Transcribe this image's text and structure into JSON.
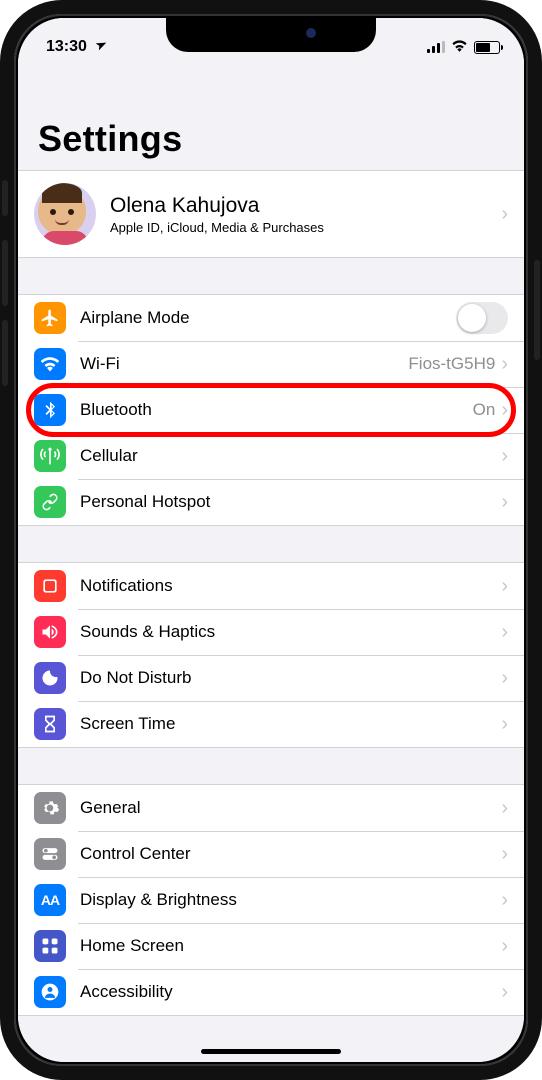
{
  "status": {
    "time": "13:30",
    "location_icon": "location-arrow",
    "signal_bars": 3,
    "wifi": true,
    "battery_percent": 60
  },
  "title": "Settings",
  "profile": {
    "name": "Olena Kahujova",
    "subtitle": "Apple ID, iCloud, Media & Purchases"
  },
  "groups": [
    {
      "rows": [
        {
          "key": "airplane",
          "label": "Airplane Mode",
          "icon": "airplane",
          "color": "#ff9500",
          "type": "toggle",
          "on": false
        },
        {
          "key": "wifi",
          "label": "Wi-Fi",
          "icon": "wifi",
          "color": "#007aff",
          "type": "link",
          "value": "Fios-tG5H9"
        },
        {
          "key": "bluetooth",
          "label": "Bluetooth",
          "icon": "bluetooth",
          "color": "#007aff",
          "type": "link",
          "value": "On",
          "highlight": true
        },
        {
          "key": "cellular",
          "label": "Cellular",
          "icon": "antenna",
          "color": "#34c759",
          "type": "link"
        },
        {
          "key": "hotspot",
          "label": "Personal Hotspot",
          "icon": "link",
          "color": "#34c759",
          "type": "link"
        }
      ]
    },
    {
      "rows": [
        {
          "key": "notifications",
          "label": "Notifications",
          "icon": "bell",
          "color": "#ff3b30",
          "type": "link"
        },
        {
          "key": "sounds",
          "label": "Sounds & Haptics",
          "icon": "speaker",
          "color": "#ff2d55",
          "type": "link"
        },
        {
          "key": "dnd",
          "label": "Do Not Disturb",
          "icon": "moon",
          "color": "#5856d6",
          "type": "link"
        },
        {
          "key": "screentime",
          "label": "Screen Time",
          "icon": "hourglass",
          "color": "#5856d6",
          "type": "link"
        }
      ]
    },
    {
      "rows": [
        {
          "key": "general",
          "label": "General",
          "icon": "gear",
          "color": "#8e8e93",
          "type": "link"
        },
        {
          "key": "controlcenter",
          "label": "Control Center",
          "icon": "switches",
          "color": "#8e8e93",
          "type": "link"
        },
        {
          "key": "display",
          "label": "Display & Brightness",
          "icon": "AA",
          "color": "#007aff",
          "type": "link"
        },
        {
          "key": "homescreen",
          "label": "Home Screen",
          "icon": "grid",
          "color": "#4556c9",
          "type": "link"
        },
        {
          "key": "accessibility",
          "label": "Accessibility",
          "icon": "person",
          "color": "#007aff",
          "type": "link"
        }
      ]
    }
  ]
}
